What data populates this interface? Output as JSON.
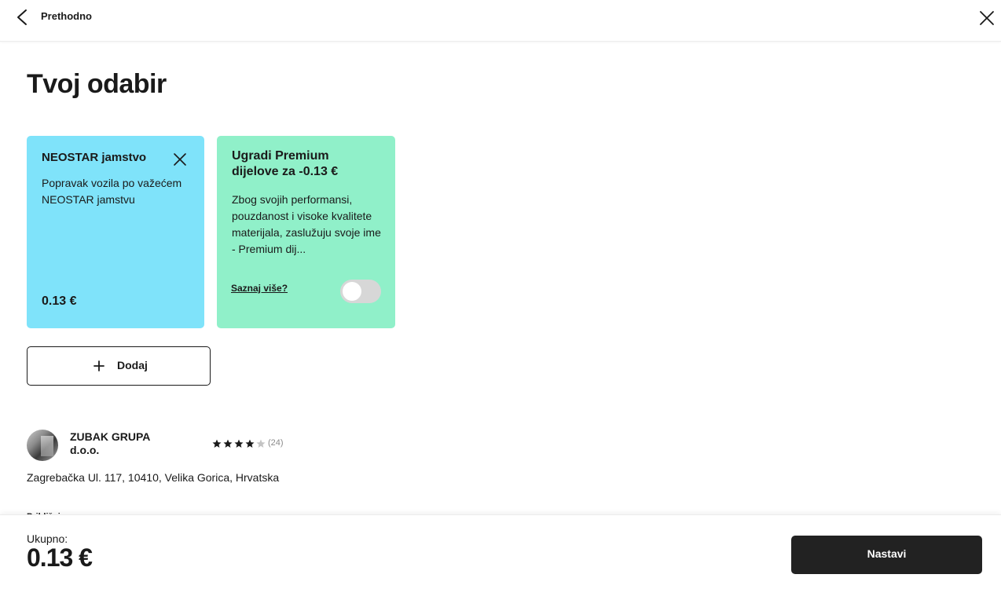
{
  "header": {
    "back_label": "Prethodno",
    "back_icon": "chevron-left-icon",
    "close_icon": "close-icon"
  },
  "page": {
    "title": "Tvoj odabir"
  },
  "selected_service": {
    "title": "NEOSTAR jamstvo",
    "description": "Popravak vozila po važećem NEOSTAR jamstvu",
    "price": "0.13 €",
    "remove_icon": "close-icon",
    "color": "#7fe3fa"
  },
  "upsell": {
    "title": "Ugradi Premium dijelove za -0.13 €",
    "description": "Zbog svojih performansi, pouzdanost i visoke kvalitete materijala, zaslužuju svoje ime - Premium dij...",
    "learn_more": "Saznaj više?",
    "toggle_on": false,
    "color": "#90f0c9"
  },
  "add_button": {
    "label": "Dodaj",
    "icon": "plus-icon"
  },
  "workshop": {
    "name": "ZUBAK GRUPA d.o.o.",
    "rating": 4,
    "rating_max": 5,
    "review_count": "(24)",
    "address": "Zagrebačka Ul. 117, 10410, Velika Gorica, Hrvatska",
    "partial_text": "Približni"
  },
  "footer": {
    "total_label": "Ukupno:",
    "total_value": "0.13 €",
    "continue_label": "Nastavi"
  }
}
